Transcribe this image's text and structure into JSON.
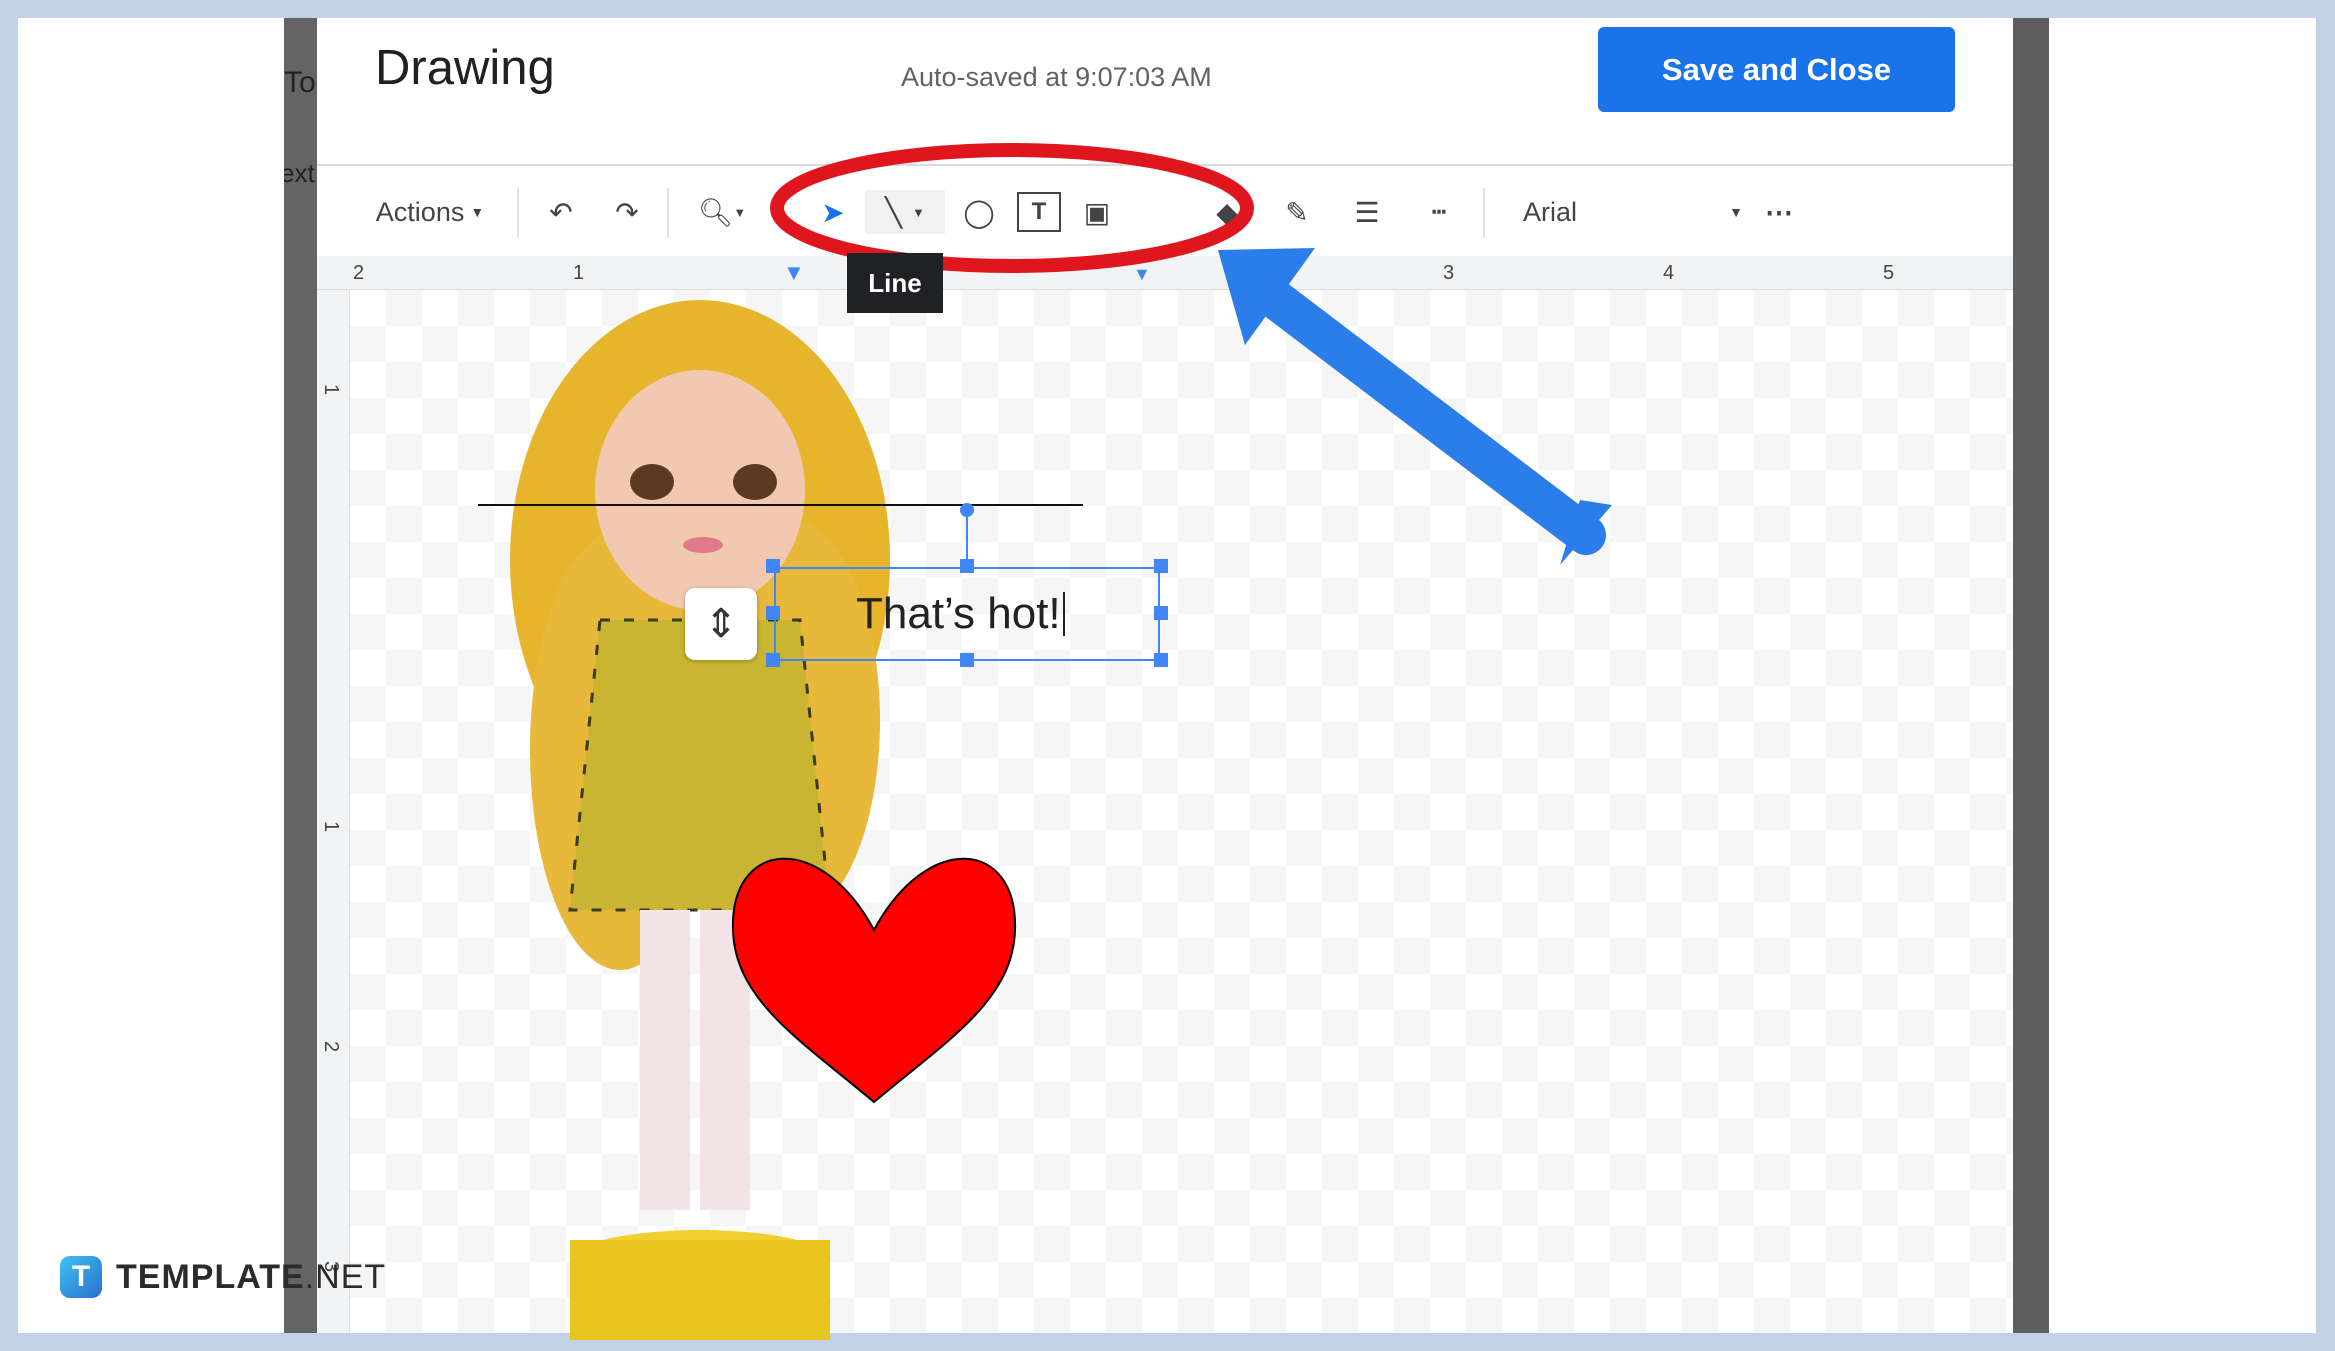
{
  "dialog": {
    "title": "Drawing",
    "autosave": "Auto-saved at 9:07:03 AM",
    "save_label": "Save and Close"
  },
  "background_doc": {
    "fragments": [
      "Too",
      "ext"
    ]
  },
  "toolbar": {
    "actions_label": "Actions",
    "font": "Arial",
    "icons": [
      "undo-icon",
      "redo-icon",
      "zoom-icon",
      "select-icon",
      "line-icon",
      "shape-icon",
      "text-box-icon",
      "image-icon",
      "fill-color-icon",
      "pen-icon",
      "line-weight-icon",
      "line-dash-icon",
      "more-icon"
    ]
  },
  "tooltip": "Line",
  "ruler": {
    "horizontal": [
      "2",
      "1",
      "3",
      "4",
      "5"
    ],
    "vertical": [
      "1",
      "1",
      "2",
      "3"
    ]
  },
  "canvas": {
    "text_box": "That’s hot!",
    "heart_color": "#ff0000"
  },
  "annotations": {
    "circle_color": "#e0161e",
    "arrow_color": "#2b7de9"
  },
  "watermark": {
    "brand": "TEMPLATE",
    "suffix": ".NET",
    "mark": "T"
  },
  "colors": {
    "accent": "#1a73e8",
    "frame": "#c3d1e4"
  }
}
